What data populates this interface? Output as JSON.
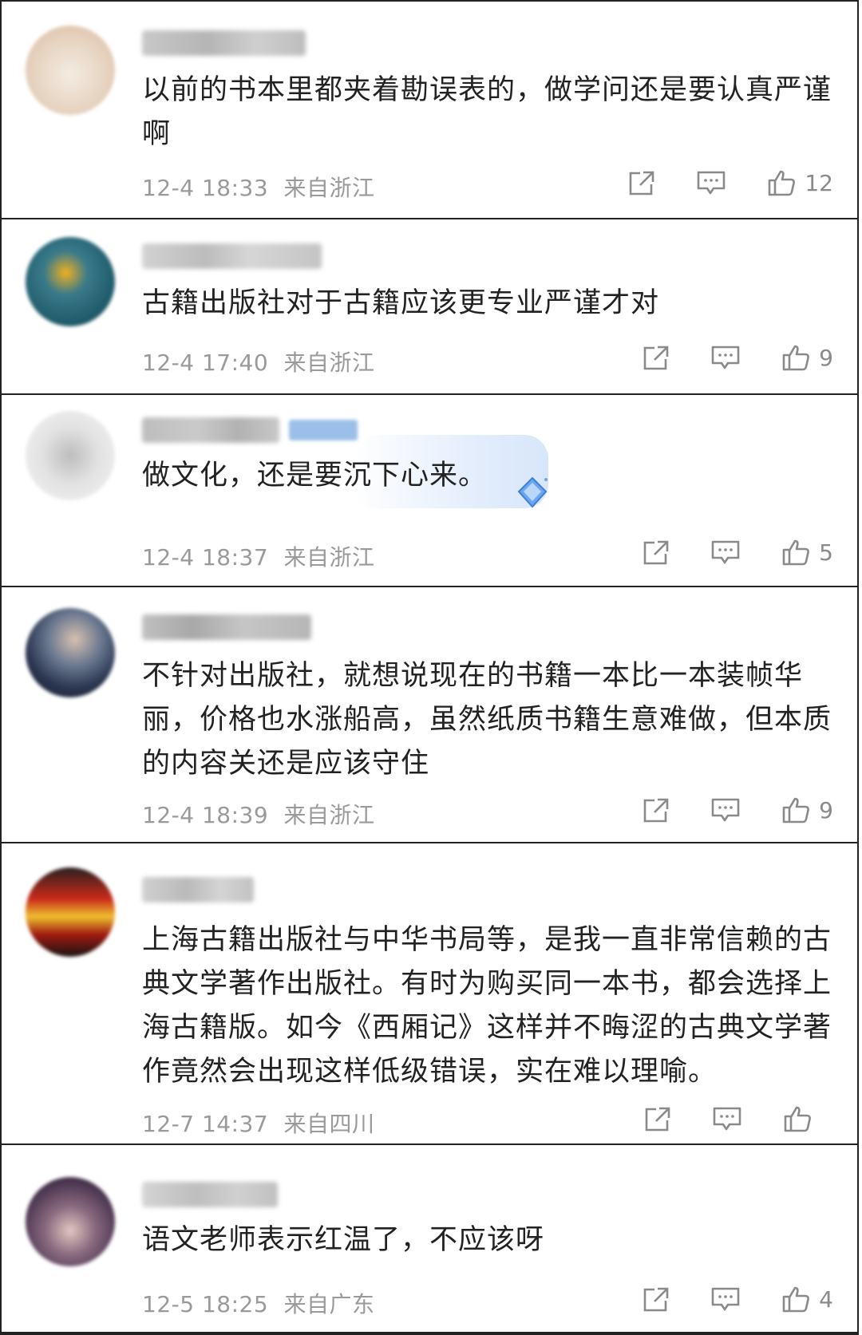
{
  "comments": [
    {
      "text": "以前的书本里都夹着勘误表的，做学问还是要认真严谨啊",
      "date": "12-4 18:33",
      "location": "来自浙江",
      "likes": "12",
      "avatar_color": "#e8d8c8"
    },
    {
      "text": "古籍出版社对于古籍应该更专业严谨才对",
      "date": "12-4 17:40",
      "location": "来自浙江",
      "likes": "9",
      "avatar_color": "#2d6e7e"
    },
    {
      "text": "做文化，还是要沉下心来。",
      "date": "12-4 18:37",
      "location": "来自浙江",
      "likes": "5",
      "avatar_color": "#d8d8d8"
    },
    {
      "text": "不针对出版社，就想说现在的书籍一本比一本装帧华丽，价格也水涨船高，虽然纸质书籍生意难做，但本质的内容关还是应该守住",
      "date": "12-4 18:39",
      "location": "来自浙江",
      "likes": "9",
      "avatar_color": "#3a4660"
    },
    {
      "text": "上海古籍出版社与中华书局等，是我一直非常信赖的古典文学著作出版社。有时为购买同一本书，都会选择上海古籍版。如今《西厢记》这样并不晦涩的古典文学著作竟然会出现这样低级错误，实在难以理喻。",
      "date": "12-7 14:37",
      "location": "来自四川",
      "likes": "",
      "avatar_color": "#8a2a1a"
    },
    {
      "text": "语文老师表示红温了，不应该呀",
      "date": "12-5 18:25",
      "location": "来自广东",
      "likes": "4",
      "avatar_color": "#5a4560"
    }
  ],
  "icons": {
    "share": "share-icon",
    "comment": "comment-icon",
    "like": "thumbs-up-icon"
  }
}
